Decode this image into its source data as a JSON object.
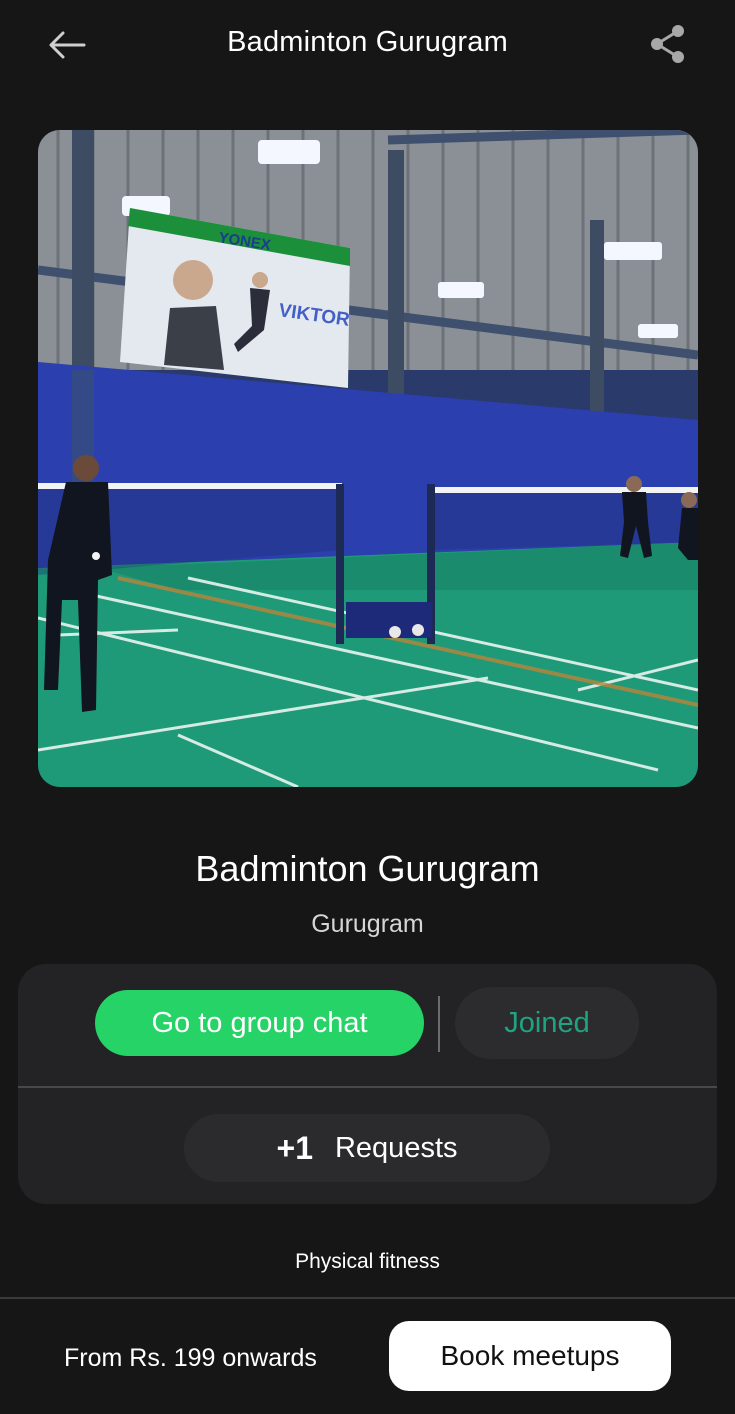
{
  "header": {
    "title": "Badminton Gurugram",
    "back_icon": "arrow-left-icon",
    "share_icon": "share-icon"
  },
  "hero": {
    "banner_brand": "YONEX",
    "banner_name": "VIKTOR"
  },
  "group": {
    "name": "Badminton Gurugram",
    "city": "Gurugram"
  },
  "actions": {
    "chat_label": "Go to group chat",
    "joined_label": "Joined",
    "requests_count": "+1",
    "requests_label": "Requests"
  },
  "category": "Physical fitness",
  "footer": {
    "price_text": "From Rs. 199 onwards",
    "book_label": "Book meetups"
  },
  "colors": {
    "background": "#161617",
    "card": "#232325",
    "accent_green": "#25d366",
    "joined_text": "#1fa381",
    "court_green": "#1e9a78",
    "wall_blue": "#2a3ea8"
  }
}
